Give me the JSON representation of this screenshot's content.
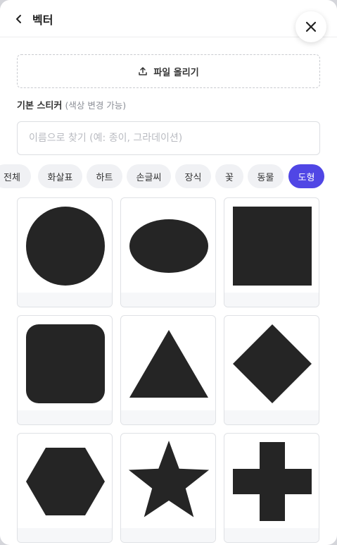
{
  "header": {
    "title": "벡터"
  },
  "upload": {
    "label": "파일 올리기"
  },
  "section": {
    "title": "기본 스티커",
    "subtitle": "(색상 변경 가능)"
  },
  "search": {
    "placeholder": "이름으로 찾기 (예: 종이, 그라데이션)",
    "value": ""
  },
  "categories": [
    {
      "label": "전체",
      "active": false
    },
    {
      "label": "화살표",
      "active": false
    },
    {
      "label": "하트",
      "active": false
    },
    {
      "label": "손글씨",
      "active": false
    },
    {
      "label": "장식",
      "active": false
    },
    {
      "label": "꽃",
      "active": false
    },
    {
      "label": "동물",
      "active": false
    },
    {
      "label": "도형",
      "active": true
    }
  ],
  "colors": {
    "accent": "#5046e5",
    "shape": "#252525"
  },
  "shapes": [
    {
      "icon": "circle-shape-icon"
    },
    {
      "icon": "ellipse-shape-icon"
    },
    {
      "icon": "square-shape-icon"
    },
    {
      "icon": "rounded-square-shape-icon"
    },
    {
      "icon": "triangle-shape-icon"
    },
    {
      "icon": "diamond-shape-icon"
    },
    {
      "icon": "hexagon-shape-icon"
    },
    {
      "icon": "star-shape-icon"
    },
    {
      "icon": "cross-shape-icon"
    }
  ]
}
